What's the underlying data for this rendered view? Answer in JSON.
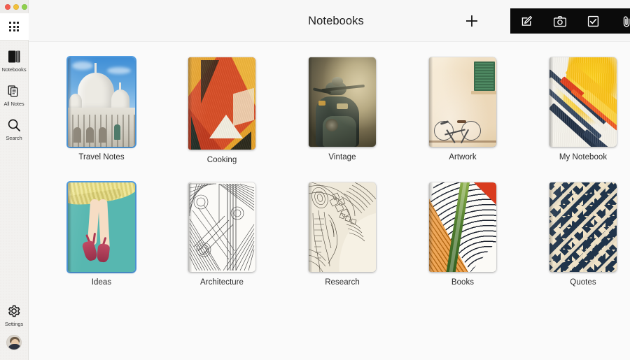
{
  "window": {
    "traffic_lights": [
      {
        "name": "close",
        "color": "#f35c4e"
      },
      {
        "name": "minimize",
        "color": "#f2c039"
      },
      {
        "name": "zoom",
        "color": "#8ed04b"
      }
    ]
  },
  "sidebar": {
    "apps_icon": "grid-icon",
    "items": [
      {
        "label": "Notebooks",
        "icon": "notebook-icon",
        "active": true
      },
      {
        "label": "All Notes",
        "icon": "documents-stack-icon",
        "active": false
      },
      {
        "label": "Search",
        "icon": "magnifier-icon",
        "active": false
      }
    ],
    "bottom": [
      {
        "label": "Settings",
        "icon": "gear-icon"
      }
    ],
    "avatar": {
      "name": "user-avatar"
    }
  },
  "header": {
    "title": "Notebooks",
    "add_button": {
      "label": "+",
      "name": "add-notebook-button"
    },
    "toolbar": {
      "background": "#0b0b0b",
      "buttons": [
        {
          "name": "new-note-button",
          "icon": "compose-icon"
        },
        {
          "name": "camera-note-button",
          "icon": "camera-icon"
        },
        {
          "name": "checklist-note-button",
          "icon": "checkbox-icon"
        },
        {
          "name": "attachment-note-button",
          "icon": "paperclip-icon"
        }
      ]
    }
  },
  "main": {
    "selection_color": "#55a2e8",
    "rows": [
      [
        {
          "label": "Travel Notes",
          "art": "a-travel",
          "selected": true
        },
        {
          "label": "Cooking",
          "art": "a-cook",
          "selected": false
        },
        {
          "label": "Vintage",
          "art": "a-vint",
          "selected": false
        },
        {
          "label": "Artwork",
          "art": "a-art",
          "selected": false
        },
        {
          "label": "My Notebook",
          "art": "a-my",
          "selected": false
        }
      ],
      [
        {
          "label": "Ideas",
          "art": "a-idea",
          "selected": true
        },
        {
          "label": "Architecture",
          "art": "a-arch",
          "selected": false
        },
        {
          "label": "Research",
          "art": "a-res",
          "selected": false
        },
        {
          "label": "Books",
          "art": "a-books",
          "selected": false
        },
        {
          "label": "Quotes",
          "art": "a-quote",
          "selected": false
        }
      ]
    ]
  }
}
